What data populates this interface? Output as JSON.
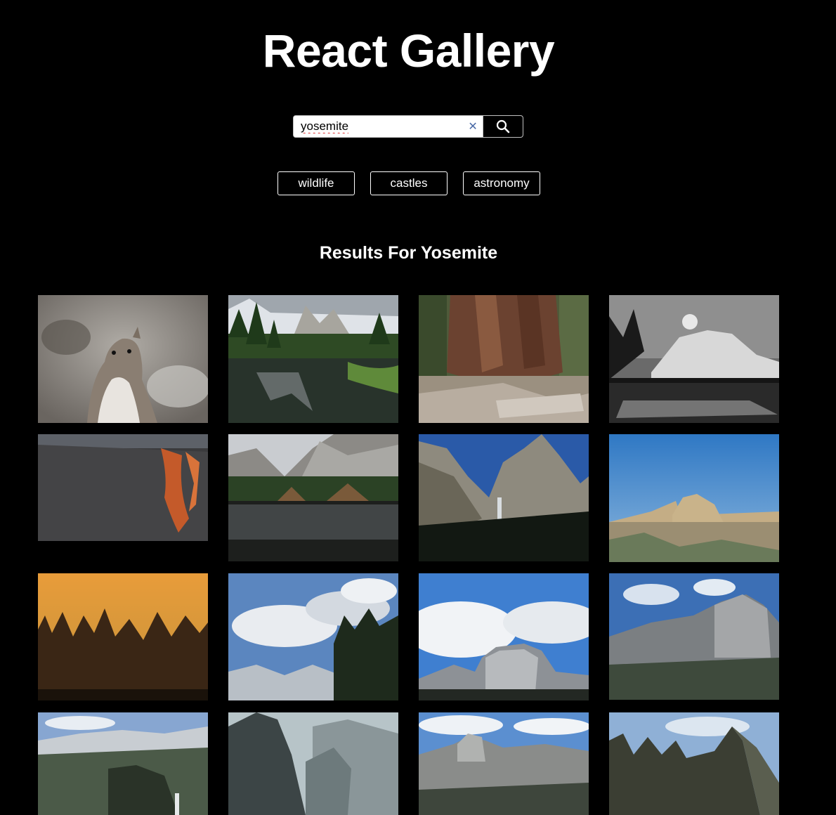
{
  "header": {
    "title": "React Gallery"
  },
  "search": {
    "value": "yosemite",
    "clear_icon": "close-icon",
    "submit_icon": "search-icon"
  },
  "nav": {
    "links": [
      "wildlife",
      "castles",
      "astronomy"
    ]
  },
  "results": {
    "heading": "Results For Yosemite"
  },
  "photos": [
    {
      "subject": "ground squirrel"
    },
    {
      "subject": "river reflection with cliffs"
    },
    {
      "subject": "giant sequoia trunk"
    },
    {
      "subject": "black and white El Capitan with moon"
    },
    {
      "subject": "horsetail fall firefall"
    },
    {
      "subject": "lake reflection with granite peak"
    },
    {
      "subject": "bridalveil fall"
    },
    {
      "subject": "half dome from glacier point"
    },
    {
      "subject": "tree silhouettes at sunset"
    },
    {
      "subject": "clouds over high sierra"
    },
    {
      "subject": "half dome with clouds"
    },
    {
      "subject": "half dome valley view"
    },
    {
      "subject": "valley panorama with waterfall"
    },
    {
      "subject": "granite spire"
    },
    {
      "subject": "half dome panorama"
    },
    {
      "subject": "cathedral rocks"
    }
  ],
  "colors": {
    "background": "#000000",
    "text": "#ffffff",
    "clear_icon": "#4a6aa6"
  }
}
